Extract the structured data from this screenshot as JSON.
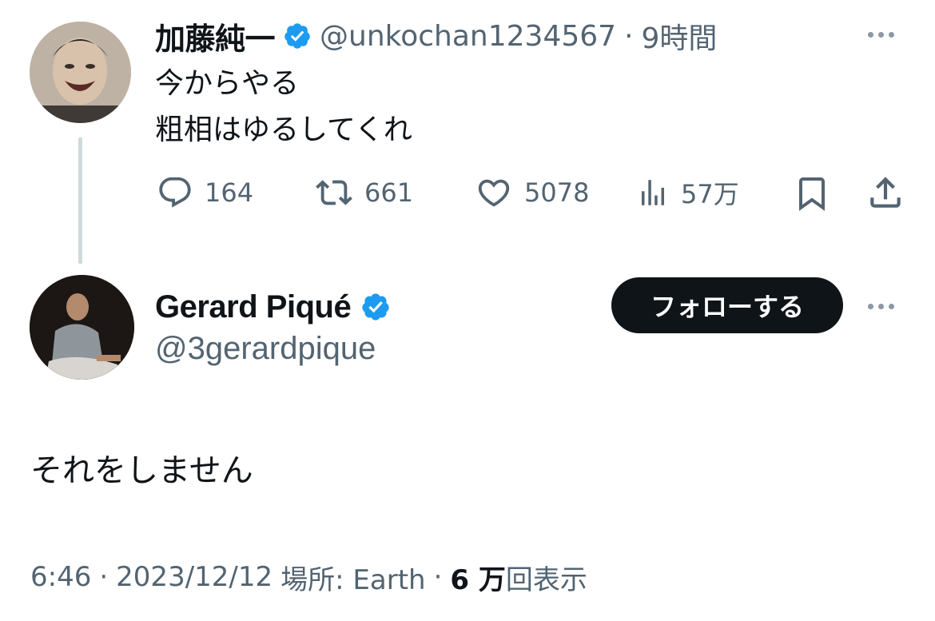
{
  "parent_tweet": {
    "author_name": "加藤純一",
    "handle": "@unkochan1234567",
    "time": "9時間",
    "separator": "·",
    "lines": [
      "今からやる",
      "粗相はゆるしてくれ"
    ],
    "actions": {
      "replies": "164",
      "retweets": "661",
      "likes": "5078",
      "views": "57万"
    }
  },
  "main_tweet": {
    "author_name": "Gerard Piqué",
    "handle": "@3gerardpique",
    "follow_label": "フォローする",
    "text": "それをしません",
    "meta": {
      "time": "6:46",
      "date": "2023/12/12",
      "location_label": "場所: Earth",
      "views_count": "6 万",
      "views_label": "回表示",
      "separator": "·"
    }
  },
  "colors": {
    "verified": "#1d9bf0",
    "text": "#0f1419",
    "muted": "#536471",
    "thread_line": "#cfd9de"
  }
}
